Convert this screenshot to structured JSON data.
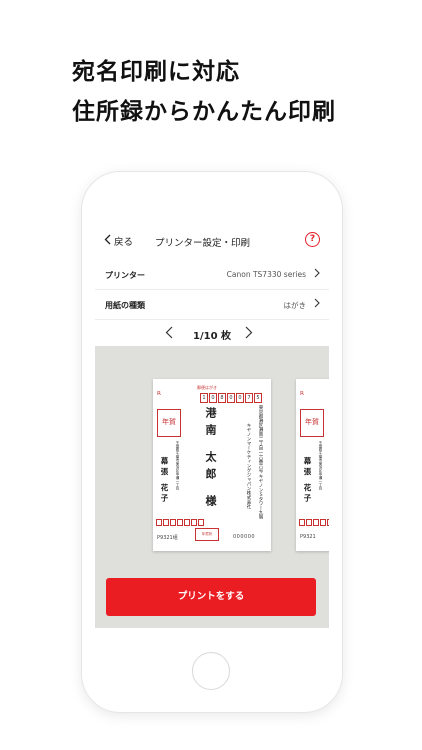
{
  "headline": {
    "line1": "宛名印刷に対応",
    "line2": "住所録からかんたん印刷"
  },
  "nav": {
    "back_label": "戻る",
    "title": "プリンター設定・印刷",
    "help_label": "?"
  },
  "settings": [
    {
      "label": "プリンター",
      "value": "Canon TS7330 series"
    },
    {
      "label": "用紙の種類",
      "value": "はがき"
    }
  ],
  "pager": {
    "current": "1/10 枚"
  },
  "postcard": {
    "title": "郵便はがき",
    "zip": [
      "1",
      "0",
      "8",
      "0",
      "0",
      "7",
      "5"
    ],
    "stamp_label": "年賀",
    "recipient_address": "東京都港区港南二丁目一六番六号 キヤノンＳタワー九階",
    "recipient_company": "キヤノンマーケティングジャパン株式会社",
    "recipient_name": "港南 太郎 様",
    "sender_address": "千葉県千葉市美浜区中瀬一丁目",
    "sender_name": "幕張 花子",
    "lottery_left": "P9321",
    "lottery_left_suffix": "组",
    "lottery_right": "000000",
    "badge": "年賀状"
  },
  "print_button": {
    "label": "プリントをする"
  },
  "colors": {
    "accent": "#ea1d23",
    "preview_bg": "#dfdfdb"
  }
}
